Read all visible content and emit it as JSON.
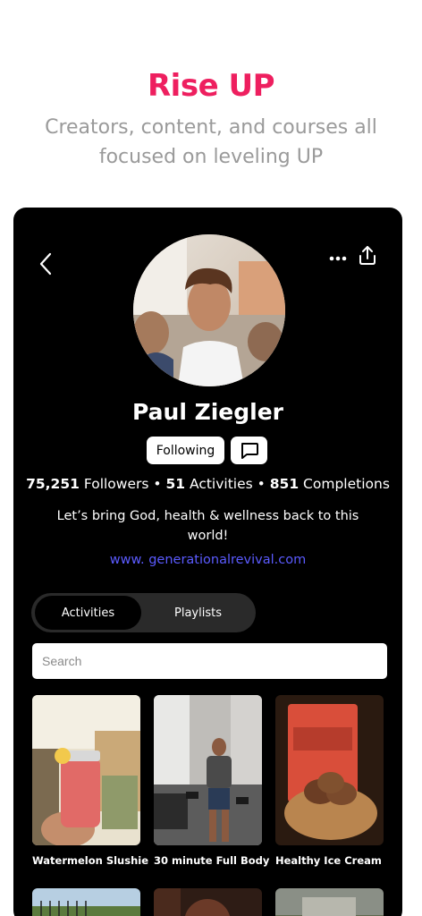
{
  "hero": {
    "title": "Rise UP",
    "subtitle": "Creators, content, and courses all focused on leveling UP"
  },
  "profile": {
    "name": "Paul Ziegler",
    "following_label": "Following",
    "stats": {
      "followers_count": "75,251",
      "followers_label": "Followers",
      "activities_count": "51",
      "activities_label": "Activities",
      "completions_count": "851",
      "completions_label": "Completions",
      "separator": "•"
    },
    "bio": "Let’s bring God, health & wellness back to this world!",
    "website": "www. generationalrevival.com"
  },
  "tabs": [
    {
      "label": "Activities",
      "selected": true
    },
    {
      "label": "Playlists",
      "selected": false
    }
  ],
  "search": {
    "placeholder": "Search",
    "value": ""
  },
  "activities": [
    {
      "title": "Watermelon Slushie"
    },
    {
      "title": "30 minute Full Body"
    },
    {
      "title": "Healthy Ice Cream"
    }
  ],
  "colors": {
    "accent": "#ee1f5f",
    "link": "#5b5bff",
    "background": "#000000"
  }
}
